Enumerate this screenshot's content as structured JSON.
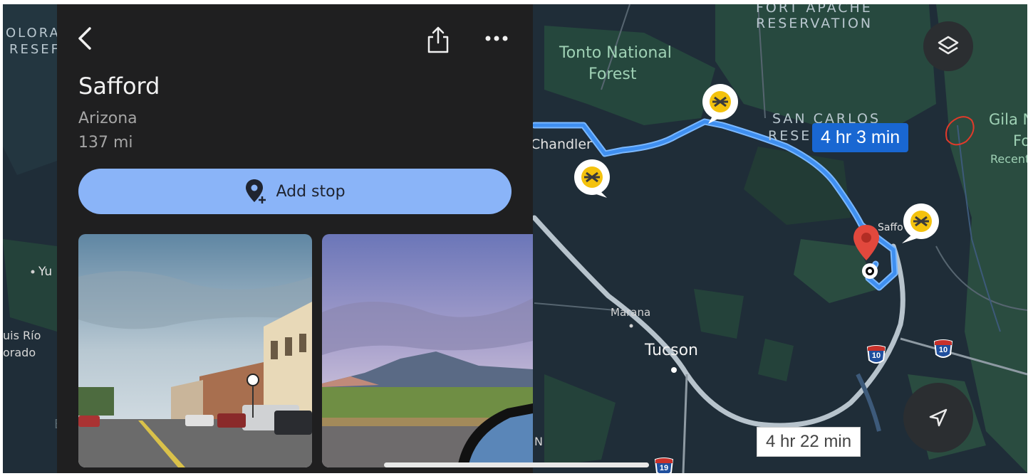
{
  "place": {
    "name": "Safford",
    "region": "Arizona",
    "distance": "137 mi"
  },
  "actions": {
    "add_stop_label": "Add stop"
  },
  "routes": {
    "primary_time": "4 hr 3 min",
    "alternate_time": "4 hr 22 min"
  },
  "map_labels": {
    "fort_apache_line1": "FORT APACHE",
    "fort_apache_line2": "RESERVATION",
    "tonto_line1": "Tonto National",
    "tonto_line2": "Forest",
    "san_carlos_line1": "SAN CARLOS",
    "san_carlos_line2": "RESE",
    "chandler": "Chandler",
    "safford_short": "Saffo",
    "gila_line1": "Gila N",
    "gila_line2": "Fo",
    "gila_line3": "Recent",
    "marana": "Marana",
    "tucson": "Tucson",
    "colorado_line1": "OLORA",
    "colorado_line2": "RESEF",
    "yuma_partial": "Yu",
    "luis_rio_line1": "uis Río",
    "luis_rio_line2": "orado",
    "n_partial": "N",
    "e_partial": "E",
    "highway_10_a": "10",
    "highway_10_b": "10",
    "highway_19": "19"
  },
  "colors": {
    "panel_bg": "#1f1f20",
    "map_bg": "#1f2d38",
    "route_blue": "#4f9bf5",
    "add_stop_bg": "#8ab4f8",
    "pin_red": "#e2483d"
  }
}
